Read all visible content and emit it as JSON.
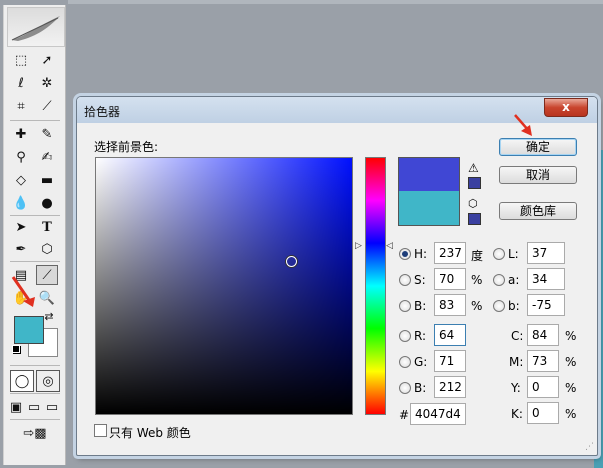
{
  "dialog": {
    "title": "拾色器",
    "close_label": "x",
    "pick_label": "选择前景色:",
    "buttons": {
      "ok": "确定",
      "cancel": "取消",
      "libraries": "颜色库"
    },
    "new_color": "#4047d4",
    "current_color": "#40b6c8",
    "hsb": [
      {
        "label": "H:",
        "value": "237",
        "unit": "度",
        "selected": true
      },
      {
        "label": "S:",
        "value": "70",
        "unit": "%",
        "selected": false
      },
      {
        "label": "B:",
        "value": "83",
        "unit": "%",
        "selected": false
      }
    ],
    "lab": [
      {
        "label": "L:",
        "value": "37"
      },
      {
        "label": "a:",
        "value": "34"
      },
      {
        "label": "b:",
        "value": "-75"
      }
    ],
    "rgb": [
      {
        "label": "R:",
        "value": "64"
      },
      {
        "label": "G:",
        "value": "71"
      },
      {
        "label": "B:",
        "value": "212"
      }
    ],
    "cmyk": [
      {
        "label": "C:",
        "value": "84",
        "unit": "%"
      },
      {
        "label": "M:",
        "value": "73",
        "unit": "%"
      },
      {
        "label": "Y:",
        "value": "0",
        "unit": "%"
      },
      {
        "label": "K:",
        "value": "0",
        "unit": "%"
      }
    ],
    "hex_label": "#",
    "hex_value": "4047d4",
    "web_only_label": "只有 Web 颜色"
  },
  "toolbox": {
    "foreground_color": "#40b6c8",
    "background_color": "#ffffff"
  },
  "icons": {
    "warning": "⚠",
    "cube": "⬡",
    "swap": "⇄"
  }
}
